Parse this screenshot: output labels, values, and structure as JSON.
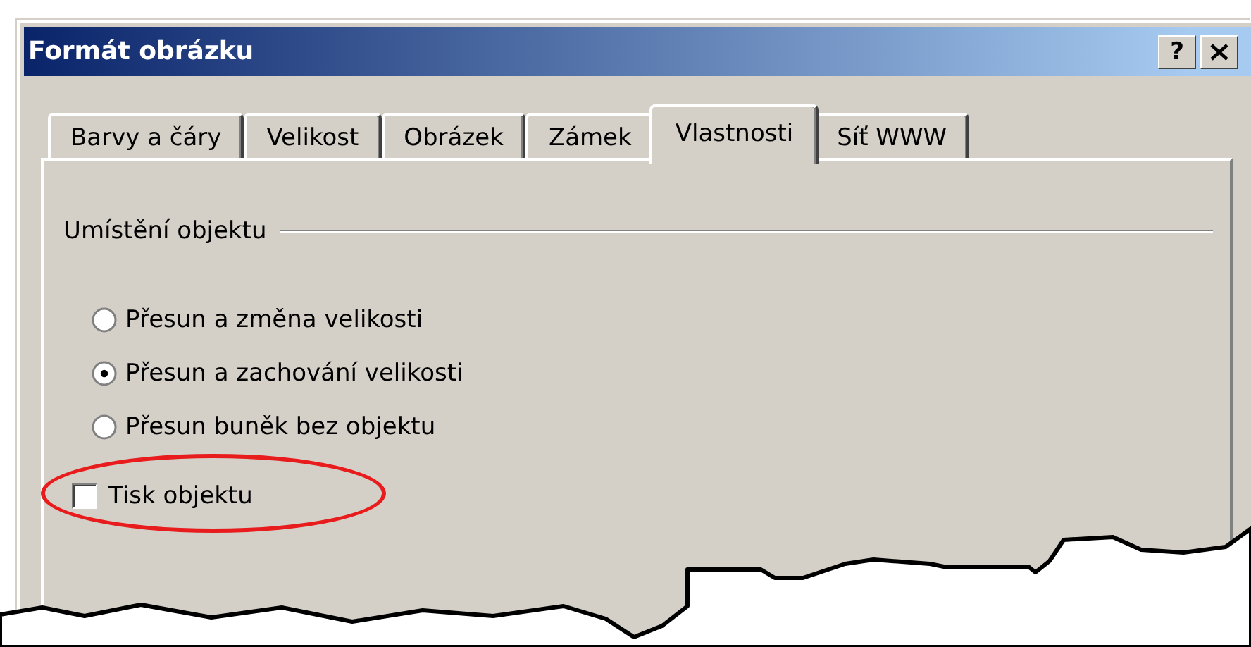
{
  "window": {
    "title": "Formát obrázku",
    "help_button": "?"
  },
  "tabs": [
    {
      "label": "Barvy a čáry",
      "selected": false
    },
    {
      "label": "Velikost",
      "selected": false
    },
    {
      "label": "Obrázek",
      "selected": false
    },
    {
      "label": "Zámek",
      "selected": false
    },
    {
      "label": "Vlastnosti",
      "selected": true
    },
    {
      "label": "Síť WWW",
      "selected": false
    }
  ],
  "group": {
    "title": "Umístění objektu",
    "options": [
      {
        "label": "Přesun a změna velikosti",
        "selected": false
      },
      {
        "label": "Přesun a zachování velikosti",
        "selected": true
      },
      {
        "label": "Přesun buněk bez objektu",
        "selected": false
      }
    ]
  },
  "print_checkbox": {
    "label": "Tisk objektu",
    "checked": false,
    "highlighted": true
  }
}
